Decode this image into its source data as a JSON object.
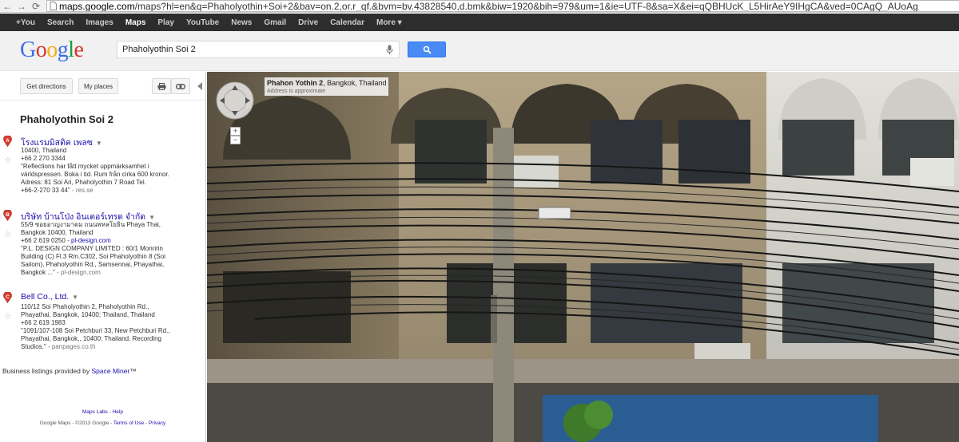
{
  "browser": {
    "url_host": "maps.google.com",
    "url_rest": "/maps?hl=en&q=Phaholyothin+Soi+2&bav=on.2,or.r_qf.&bvm=bv.43828540,d.bmk&biw=1920&bih=979&um=1&ie=UTF-8&sa=X&ei=qQBHUcK_L5HirAeY9IHgCA&ved=0CAgQ_AUoAg"
  },
  "gbar": {
    "items": [
      {
        "label": "+You"
      },
      {
        "label": "Search"
      },
      {
        "label": "Images"
      },
      {
        "label": "Maps"
      },
      {
        "label": "Play"
      },
      {
        "label": "YouTube"
      },
      {
        "label": "News"
      },
      {
        "label": "Gmail"
      },
      {
        "label": "Drive"
      },
      {
        "label": "Calendar"
      },
      {
        "label": "More ▾"
      }
    ],
    "active": "Maps"
  },
  "header": {
    "logo": "Google",
    "search_value": "Phaholyothin Soi 2"
  },
  "toolbar": {
    "directions_label": "Get directions",
    "myplaces_label": "My places"
  },
  "results": {
    "title": "Phaholyothin Soi 2",
    "items": [
      {
        "marker": "A",
        "name": "โรงแรมมิสติค เพลซ",
        "lines": [
          "10400, Thailand",
          "+66 2 270 3344",
          "\"Reflections har fått mycket uppmärksamhet i",
          "världspressen. Boka i tid. Rum från cirka 600 kronor.",
          "Adress: 81 Soi Ari, Phaholyothin 7 Road Tel.",
          "+66-2-270 33 44\""
        ],
        "source": " - res.se"
      },
      {
        "marker": "B",
        "name": "บริษัท บ้านโป่ง อินเตอร์เทรด จำกัด",
        "lines": [
          "55/9 ซอยอาญงามาดม ถนนพหลโยธิน Phaya Thai,",
          "Bangkok 10400, Thailand",
          "+66 2 619 0250"
        ],
        "link": "pl-design.com",
        "lines2": [
          "\"P.L. DESIGN COMPANY LIMITED : 60/1 Monririn",
          "Building (C) Fl.3 Rm.C302, Soi Phaholyothin 8 (Soi",
          "Sailom), Phaholyothin Rd., Samsennai, Phayathai,",
          "Bangkok ...\""
        ],
        "source": " - pl-design.com"
      },
      {
        "marker": "C",
        "name": "Bell Co., Ltd.",
        "lines": [
          "110/12 Soi Phaholyothin 2, Phaholyothin Rd.,",
          "Phayathai, Bangkok, 10400; Thailand, Thailand",
          "+66 2 619 1983",
          "\"1091/107-108 Soi Petchburi 33, New Petchburi Rd.,",
          "Phayathai, Bangkok,, 10400; Thailand. Recording",
          "Studios.\""
        ],
        "source": " - panpages.co.th"
      }
    ]
  },
  "listings": {
    "prefix": "Business listings provided by ",
    "link": "Space Miner",
    "suffix": "™"
  },
  "footer": {
    "labs": "Maps Labs",
    "sep": " - ",
    "help": "Help",
    "copyright": "Google Maps - ©2013 Google - ",
    "terms": "Terms of Use",
    "privacy": "Privacy"
  },
  "streetview": {
    "place_bold": "Phahon Yothin 2",
    "place_rest": ", Bangkok, Thailand",
    "note": "Address is approximate"
  },
  "icons": {
    "back": "back-arrow-icon",
    "forward": "forward-arrow-icon",
    "reload": "reload-icon",
    "page": "page-icon",
    "mic": "microphone-icon",
    "search": "magnifier-icon",
    "print": "printer-icon",
    "link": "link-icon",
    "collapse": "collapse-triangle-icon",
    "compass": "pan-compass-icon",
    "marker": "map-marker-icon",
    "star": "star-icon"
  },
  "colors": {
    "gbar_bg": "#2d2d2d",
    "search_button": "#4a8af4",
    "marker": "#d83c2f",
    "link": "#1a0dab"
  }
}
